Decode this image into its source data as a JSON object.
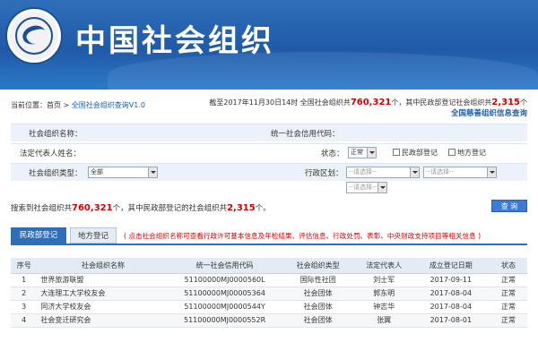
{
  "header": {
    "title": "中国社会组织"
  },
  "breadcrumb": {
    "prefix": "当前位置：首页 > ",
    "current": "全国社会组织查询V1.0"
  },
  "summary": {
    "text_a": "截至2017年11月30日14时 全国社会组织共",
    "total": "760,321",
    "text_b": "个，其中民政部登记社会组织共",
    "ministry": "2,315",
    "text_c": "个",
    "charity_link": "全国慈善组织信息查询"
  },
  "form": {
    "org_name_label": "社会组织名称：",
    "credit_code_label": "统一社会信用代码：",
    "rep_label": "法定代表人姓名：",
    "status_label": "状态：",
    "status_value": "正常",
    "ministry_check_label": "民政部登记",
    "local_check_label": "地方登记",
    "type_label": "社会组织类型：",
    "type_value": "全部",
    "region_label": "行政区划：",
    "region_placeholder_1": "--请选择--",
    "region_placeholder_2": "--请选择--",
    "region_placeholder_3": "--请选择--"
  },
  "result": {
    "text_a": "搜索到社会组织共",
    "total": "760,321",
    "text_b": "个，其中民政部登记的社会组织共",
    "ministry": "2,315",
    "text_c": "个。",
    "search_button": "查 询"
  },
  "tabs": {
    "ministry": "民政部登记",
    "local": "地方登记"
  },
  "notice": "( 点击社会组织名称可查看行政许可基本信息及年检结果、评估信息、行政处罚、表彰、中央财政支持项目等相关信息 )",
  "table": {
    "headers": [
      "序号",
      "社会组织名称",
      "统一社会信用代码",
      "社会组织类型",
      "法定代表人",
      "成立登记日期",
      "状态"
    ],
    "rows": [
      [
        "1",
        "世界旅游联盟",
        "51100000MJ0000560L",
        "国际性社团",
        "刘士军",
        "2017-09-11",
        "正常"
      ],
      [
        "2",
        "大连理工大学校友会",
        "51100000MJ00005364",
        "社会团体",
        "郭东明",
        "2017-08-04",
        "正常"
      ],
      [
        "3",
        "同济大学校友会",
        "51100000MJ0000544Y",
        "社会团体",
        "钟志华",
        "2017-08-04",
        "正常"
      ],
      [
        "4",
        "社会变迁研究会",
        "51100000MJ0000552R",
        "社会团体",
        "张翼",
        "2017-08-01",
        "正常"
      ]
    ]
  },
  "colors": {
    "brand_blue": "#2f6fb8",
    "highlight_red": "#d00000",
    "link_blue": "#1a5fb4"
  }
}
